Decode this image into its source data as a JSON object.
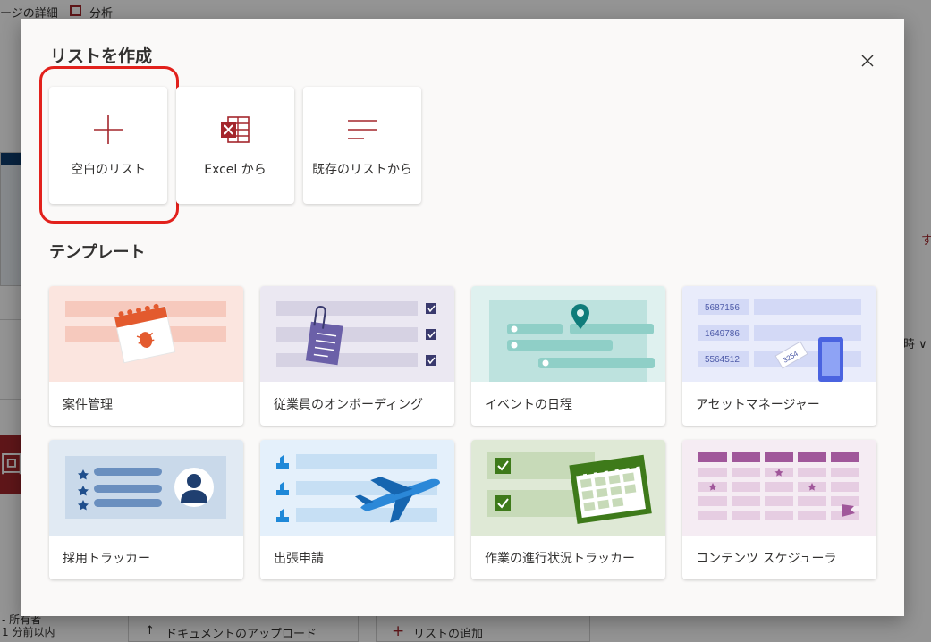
{
  "background": {
    "top_text_1": "ージの詳細",
    "top_text_2": "分析",
    "red_tile_char": "回",
    "right_text_1": "す",
    "right_text_2": "時 ∨",
    "owner_text_1": "- 所有者",
    "owner_text_2": "1 分前以内",
    "upload_label": "ドキュメントのアップロード",
    "add_list_label": "リストの追加"
  },
  "dialog": {
    "title": "リストを作成",
    "section_title": "テンプレート",
    "create_options": [
      {
        "label": "空白のリスト",
        "icon": "plus-icon"
      },
      {
        "label": "Excel から",
        "icon": "excel-icon"
      },
      {
        "label": "既存のリストから",
        "icon": "list-lines-icon"
      }
    ],
    "templates": [
      {
        "label": "案件管理",
        "icon": "calendar-bug-illustration"
      },
      {
        "label": "従業員のオンボーディング",
        "icon": "checklist-clip-illustration"
      },
      {
        "label": "イベントの日程",
        "icon": "map-pin-illustration"
      },
      {
        "label": "アセットマネージャー",
        "icon": "asset-tag-illustration",
        "numbers": [
          "5687156",
          "1649786",
          "5564512"
        ],
        "tag": "3254"
      },
      {
        "label": "採用トラッカー",
        "icon": "candidate-profile-illustration"
      },
      {
        "label": "出張申請",
        "icon": "airplane-illustration"
      },
      {
        "label": "作業の進行状況トラッカー",
        "icon": "progress-calendar-illustration"
      },
      {
        "label": "コンテンツ スケジューラ",
        "icon": "content-calendar-illustration"
      }
    ]
  },
  "colors": {
    "accent": "#a4262c",
    "highlight": "#e2211c"
  }
}
